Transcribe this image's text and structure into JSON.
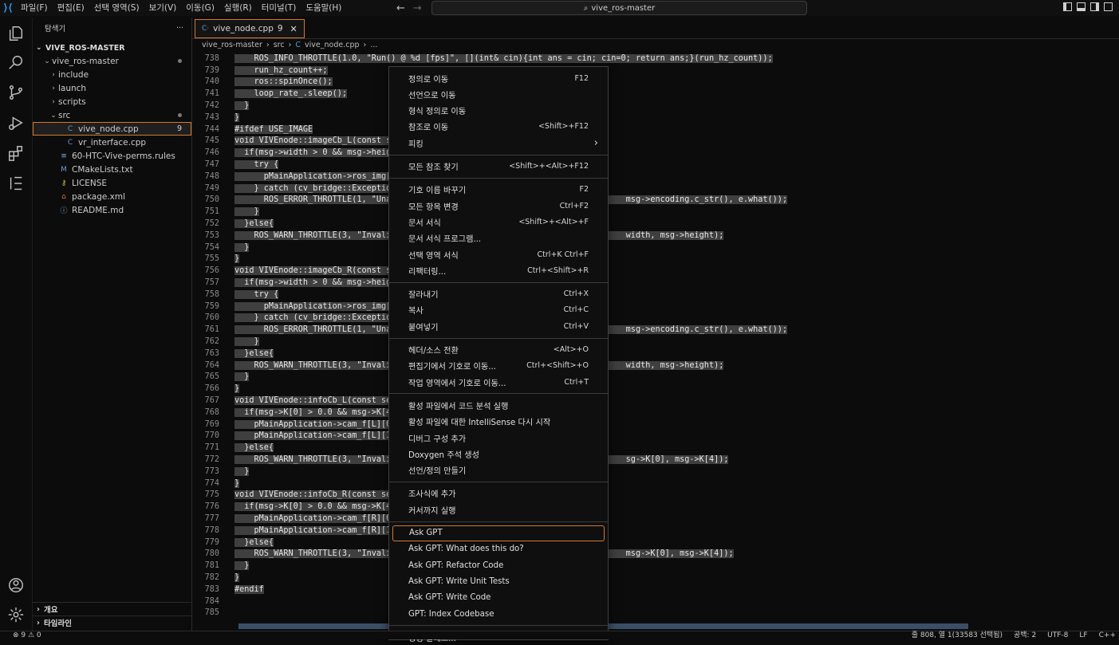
{
  "titlebar": {
    "menu": [
      "파일(F)",
      "편집(E)",
      "선택 영역(S)",
      "보기(V)",
      "이동(G)",
      "실행(R)",
      "터미널(T)",
      "도움말(H)"
    ],
    "search": "vive_ros-master"
  },
  "sidebar": {
    "title": "탐색기",
    "more": "···",
    "root": "VIVE_ROS-MASTER",
    "items": [
      {
        "label": "vive_ros-master",
        "indent": 1,
        "chevron": "down",
        "icon": "",
        "dot": true
      },
      {
        "label": "include",
        "indent": 2,
        "chevron": "right",
        "icon": ""
      },
      {
        "label": "launch",
        "indent": 2,
        "chevron": "right",
        "icon": ""
      },
      {
        "label": "scripts",
        "indent": 2,
        "chevron": "right",
        "icon": ""
      },
      {
        "label": "src",
        "indent": 2,
        "chevron": "down",
        "icon": "",
        "dot": true
      },
      {
        "label": "vive_node.cpp",
        "indent": 3,
        "chevron": "",
        "icon": "C",
        "badge": "9",
        "selected": true
      },
      {
        "label": "vr_interface.cpp",
        "indent": 3,
        "chevron": "",
        "icon": "C"
      },
      {
        "label": "60-HTC-Vive-perms.rules",
        "indent": 2,
        "chevron": "",
        "icon": "≡"
      },
      {
        "label": "CMakeLists.txt",
        "indent": 2,
        "chevron": "",
        "icon": "M"
      },
      {
        "label": "LICENSE",
        "indent": 2,
        "chevron": "",
        "icon": "⚷"
      },
      {
        "label": "package.xml",
        "indent": 2,
        "chevron": "",
        "icon": "⌂"
      },
      {
        "label": "README.md",
        "indent": 2,
        "chevron": "",
        "icon": "ⓘ"
      }
    ],
    "outline": "개요",
    "timeline": "타임라인"
  },
  "editor": {
    "tab": {
      "label": "vive_node.cpp",
      "badge": "9"
    },
    "breadcrumb": [
      "vive_ros-master",
      "src",
      "vive_node.cpp",
      "..."
    ],
    "lines": [
      {
        "n": "738",
        "t": "    ROS_INFO_THROTTLE(1.0, \"Run() @ %d [fps]\", [](int& cin){int ans = cin; cin=0; return ans;}(run_hz_count));"
      },
      {
        "n": "739",
        "t": "    run_hz_count++;"
      },
      {
        "n": "740",
        "t": "    ros::spinOnce();"
      },
      {
        "n": "741",
        "t": "    loop_rate_.sleep();"
      },
      {
        "n": "742",
        "t": "  }"
      },
      {
        "n": "743",
        "t": "}"
      },
      {
        "n": "744",
        "t": "#ifdef USE_IMAGE"
      },
      {
        "n": "745",
        "t": "void VIVEnode::imageCb_L(const se"
      },
      {
        "n": "746",
        "t": "  if(msg->width > 0 && msg->heig"
      },
      {
        "n": "747",
        "t": "    try {"
      },
      {
        "n": "748",
        "t": "      pMainApplication->ros_img["
      },
      {
        "n": "749",
        "t": "    } catch (cv_bridge::Exceptio"
      },
      {
        "n": "750",
        "t": "      ROS_ERROR_THROTTLE(1, \"Una                                                msg->encoding.c_str(), e.what());"
      },
      {
        "n": "751",
        "t": "    }"
      },
      {
        "n": "752",
        "t": "  }else{"
      },
      {
        "n": "753",
        "t": "    ROS_WARN_THROTTLE(3, \"Invali                                                width, msg->height);"
      },
      {
        "n": "754",
        "t": "  }"
      },
      {
        "n": "755",
        "t": "}"
      },
      {
        "n": "756",
        "t": "void VIVEnode::imageCb_R(const s"
      },
      {
        "n": "757",
        "t": "  if(msg->width > 0 && msg->heig"
      },
      {
        "n": "758",
        "t": "    try {"
      },
      {
        "n": "759",
        "t": "      pMainApplication->ros_img["
      },
      {
        "n": "760",
        "t": "    } catch (cv_bridge::Exceptio"
      },
      {
        "n": "761",
        "t": "      ROS_ERROR_THROTTLE(1, \"Una                                                msg->encoding.c_str(), e.what());"
      },
      {
        "n": "762",
        "t": "    }"
      },
      {
        "n": "763",
        "t": "  }else{"
      },
      {
        "n": "764",
        "t": "    ROS_WARN_THROTTLE(3, \"Invali                                                width, msg->height);"
      },
      {
        "n": "765",
        "t": "  }"
      },
      {
        "n": "766",
        "t": "}"
      },
      {
        "n": "767",
        "t": "void VIVEnode::infoCb_L(const se"
      },
      {
        "n": "768",
        "t": "  if(msg->K[0] > 0.0 && msg->K[4"
      },
      {
        "n": "769",
        "t": "    pMainApplication->cam_f[L][0"
      },
      {
        "n": "770",
        "t": "    pMainApplication->cam_f[L][1"
      },
      {
        "n": "771",
        "t": "  }else{"
      },
      {
        "n": "772",
        "t": "    ROS_WARN_THROTTLE(3, \"Invali                                                sg->K[0], msg->K[4]);"
      },
      {
        "n": "773",
        "t": "  }"
      },
      {
        "n": "774",
        "t": "}"
      },
      {
        "n": "775",
        "t": "void VIVEnode::infoCb_R(const se"
      },
      {
        "n": "776",
        "t": "  if(msg->K[0] > 0.0 && msg->K[4"
      },
      {
        "n": "777",
        "t": "    pMainApplication->cam_f[R][0"
      },
      {
        "n": "778",
        "t": "    pMainApplication->cam_f[R][1"
      },
      {
        "n": "779",
        "t": "  }else{"
      },
      {
        "n": "780",
        "t": "    ROS_WARN_THROTTLE(3, \"Invali                                                msg->K[0], msg->K[4]);"
      },
      {
        "n": "781",
        "t": "  }"
      },
      {
        "n": "782",
        "t": "}"
      },
      {
        "n": "783",
        "t": "#endif"
      },
      {
        "n": "784",
        "t": ""
      },
      {
        "n": "785",
        "t": ""
      }
    ]
  },
  "context_menu": {
    "groups": [
      [
        {
          "label": "정의로 이동",
          "kb": "F12"
        },
        {
          "label": "선언으로 이동",
          "kb": ""
        },
        {
          "label": "형식 정의로 이동",
          "kb": ""
        },
        {
          "label": "참조로 이동",
          "kb": "<Shift>+F12"
        },
        {
          "label": "피킹",
          "kb": "›"
        }
      ],
      [
        {
          "label": "모든 참조 찾기",
          "kb": "<Shift>+<Alt>+F12"
        }
      ],
      [
        {
          "label": "기호 이름 바꾸기",
          "kb": "F2"
        },
        {
          "label": "모든 항목 변경",
          "kb": "Ctrl+F2"
        },
        {
          "label": "문서 서식",
          "kb": "<Shift>+<Alt>+F"
        },
        {
          "label": "문서 서식 프로그램...",
          "kb": ""
        },
        {
          "label": "선택 영역 서식",
          "kb": "Ctrl+K Ctrl+F"
        },
        {
          "label": "리팩터링...",
          "kb": "Ctrl+<Shift>+R"
        }
      ],
      [
        {
          "label": "잘라내기",
          "kb": "Ctrl+X"
        },
        {
          "label": "복사",
          "kb": "Ctrl+C"
        },
        {
          "label": "붙여넣기",
          "kb": "Ctrl+V"
        }
      ],
      [
        {
          "label": "헤더/소스 전환",
          "kb": "<Alt>+O"
        },
        {
          "label": "편집기에서 기호로 이동...",
          "kb": "Ctrl+<Shift>+O"
        },
        {
          "label": "작업 영역에서 기호로 이동...",
          "kb": "Ctrl+T"
        }
      ],
      [
        {
          "label": "활성 파일에서 코드 분석 실행",
          "kb": ""
        },
        {
          "label": "활성 파일에 대한 IntelliSense 다시 시작",
          "kb": ""
        },
        {
          "label": "디버그 구성 추가",
          "kb": ""
        },
        {
          "label": "Doxygen 주석 생성",
          "kb": ""
        },
        {
          "label": "선언/정의 만들기",
          "kb": ""
        }
      ],
      [
        {
          "label": "조사식에 추가",
          "kb": ""
        },
        {
          "label": "커서까지 실행",
          "kb": ""
        }
      ],
      [
        {
          "label": "Ask GPT",
          "kb": "",
          "highlight": true
        },
        {
          "label": "Ask GPT: What does this do?",
          "kb": ""
        },
        {
          "label": "Ask GPT: Refactor Code",
          "kb": ""
        },
        {
          "label": "Ask GPT: Write Unit Tests",
          "kb": ""
        },
        {
          "label": "Ask GPT: Write Code",
          "kb": ""
        },
        {
          "label": "GPT: Index Codebase",
          "kb": ""
        }
      ],
      [
        {
          "label": "명령 팔레트...",
          "kb": "Ctrl+<Shift>+P"
        }
      ]
    ]
  },
  "statusbar": {
    "problems": "⊗ 9 ⚠ 0",
    "position": "줄 808, 열 1(33583 선택됨)",
    "spaces": "공백: 2",
    "encoding": "UTF-8",
    "eol": "LF",
    "lang": "C++"
  }
}
